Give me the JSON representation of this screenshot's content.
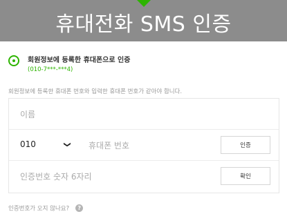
{
  "header": {
    "title": "휴대전화 SMS 인증"
  },
  "auth_option": {
    "label": "회원정보에 등록한 휴대폰으로 인증",
    "masked_number": "(010-7***-***4)",
    "selected": true
  },
  "notice": "회원정보에 등록한 휴대폰 번호와 입력한 휴대폰 번호가 같아야 합니다.",
  "form": {
    "name_placeholder": "이름",
    "carrier_prefix": "010",
    "phone_placeholder": "휴대폰 번호",
    "request_button": "인증",
    "code_placeholder": "인증번호 숫자 6자리",
    "confirm_button": "확인"
  },
  "help": {
    "text": "인증번호가 오지 않나요?",
    "icon": "?"
  },
  "colors": {
    "header_bg": "#8c8c8c",
    "accent": "#2db400"
  }
}
